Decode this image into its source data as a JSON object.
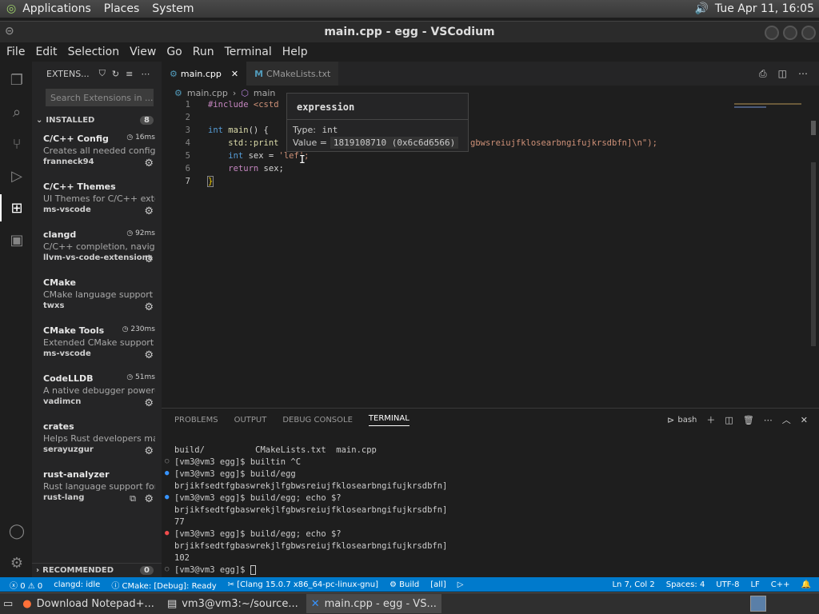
{
  "topbar": {
    "menus": [
      "Applications",
      "Places",
      "System"
    ],
    "clock": "Tue Apr 11, 16:05"
  },
  "window": {
    "title": "main.cpp - egg - VSCodium"
  },
  "menubar": [
    "File",
    "Edit",
    "Selection",
    "View",
    "Go",
    "Run",
    "Terminal",
    "Help"
  ],
  "sidebar": {
    "header": "EXTENS...",
    "search_placeholder": "Search Extensions in ...",
    "installed_label": "INSTALLED",
    "installed_count": "8",
    "extensions": [
      {
        "name": "C/C++ Config",
        "desc": "Creates all needed config ...",
        "publisher": "franneck94",
        "time": "16ms"
      },
      {
        "name": "C/C++ Themes",
        "desc": "UI Themes for C/C++ exte...",
        "publisher": "ms-vscode",
        "time": ""
      },
      {
        "name": "clangd",
        "desc": "C/C++ completion, navigat...",
        "publisher": "llvm-vs-code-extensions",
        "time": "92ms"
      },
      {
        "name": "CMake",
        "desc": "CMake language support f...",
        "publisher": "twxs",
        "time": ""
      },
      {
        "name": "CMake Tools",
        "desc": "Extended CMake support i...",
        "publisher": "ms-vscode",
        "time": "230ms"
      },
      {
        "name": "CodeLLDB",
        "desc": "A native debugger powere...",
        "publisher": "vadimcn",
        "time": "51ms"
      },
      {
        "name": "crates",
        "desc": "Helps Rust developers ma...",
        "publisher": "serayuzgur",
        "time": ""
      },
      {
        "name": "rust-analyzer",
        "desc": "Rust language support for...",
        "publisher": "rust-lang",
        "time": ""
      }
    ],
    "recommended_label": "RECOMMENDED",
    "recommended_count": "0"
  },
  "tabs": [
    {
      "label": "main.cpp"
    },
    {
      "label": "CMakeLists.txt"
    }
  ],
  "breadcrumb": {
    "file": "main.cpp",
    "symbol": "main"
  },
  "editor": {
    "line_numbers": [
      "1",
      "2",
      "3",
      "4",
      "5",
      "6",
      "7"
    ],
    "l1a": "#include ",
    "l1b": "<cstd",
    "l3a": "int ",
    "l3b": "main",
    "l3c": "() {",
    "l4a": "    std::print",
    "l4b": "gbwsreiujfklosearbngifujkrsdbfn]\\n\");",
    "l5a": "    int ",
    "l5b": "sex = ",
    "l5c": "'l",
    "l5d": "ef';",
    "l6a": "    return ",
    "l6b": "sex;",
    "l7": "}"
  },
  "hover": {
    "title": "expression",
    "type_label": "Type:",
    "type_value": "int",
    "value_label": "Value =",
    "value_value": "1819108710 (0x6c6d6566)"
  },
  "panel": {
    "tabs": [
      "PROBLEMS",
      "OUTPUT",
      "DEBUG CONSOLE",
      "TERMINAL"
    ],
    "shell": "bash",
    "lines": [
      "build/          CMakeLists.txt  main.cpp",
      "[vm3@vm3 egg]$ builtin ^C",
      "[vm3@vm3 egg]$ build/egg",
      "brjikfsedtfgbaswrekjlfgbwsreiujfklosearbngifujkrsdbfn]",
      "[vm3@vm3 egg]$ build/egg; echo $?",
      "brjikfsedtfgbaswrekjlfgbwsreiujfklosearbngifujkrsdbfn]",
      "77",
      "[vm3@vm3 egg]$ build/egg; echo $?",
      "brjikfsedtfgbaswrekjlfgbwsreiujfklosearbngifujkrsdbfn]",
      "102",
      "[vm3@vm3 egg]$ "
    ]
  },
  "status": {
    "errors": "0",
    "warnings": "0",
    "clangd": "clangd: idle",
    "cmake": "CMake: [Debug]: Ready",
    "kit": "[Clang 15.0.7 x86_64-pc-linux-gnu]",
    "build": "Build",
    "target": "[all]",
    "position": "Ln 7, Col 2",
    "spaces": "Spaces: 4",
    "encoding": "UTF-8",
    "eol": "LF",
    "lang": "C++"
  },
  "taskbar": [
    "Download Notepad+...",
    "vm3@vm3:~/source...",
    "main.cpp - egg - VS..."
  ],
  "colors": {
    "accent": "#007acc",
    "keyword": "#569cd6",
    "function": "#dcdcaa",
    "string": "#ce9178"
  }
}
